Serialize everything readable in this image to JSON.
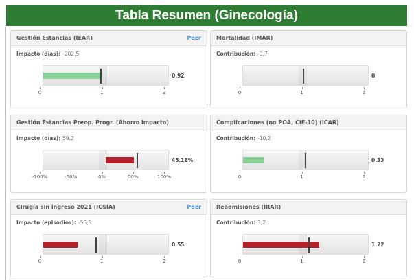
{
  "title": "Tabla Resumen (Ginecología)",
  "colors": {
    "header": "#2f7d32",
    "good": "#86cf96",
    "bad": "#b5212b",
    "peer": "#4a90d9"
  },
  "cards": [
    {
      "title": "Gestión Estancias (IEAR)",
      "peer": "Peer",
      "metric_label": "Impacto (días):",
      "metric_value": "-202,5",
      "value_label": "0.92",
      "value": 0.92,
      "marker": 0.92,
      "min": 0,
      "max": 2,
      "ref": 1,
      "ticks": [
        "0",
        "1",
        "2"
      ],
      "bar_color": "good"
    },
    {
      "title": "Mortalidad (IMAR)",
      "peer": "",
      "metric_label": "Contribución:",
      "metric_value": "-0,7",
      "value_label": "0",
      "value": 0,
      "marker": 0.97,
      "min": 0,
      "max": 2,
      "ref": 1,
      "ticks": [
        "0",
        "1",
        "2"
      ],
      "bar_color": "good"
    },
    {
      "title": "Gestión Estancias Preop. Progr. (Ahorro impacto)",
      "peer": "",
      "metric_label": "Impacto (días):",
      "metric_value": "59,2",
      "value_label": "45.18%",
      "value": 45.18,
      "marker": 50,
      "min": -100,
      "max": 100,
      "ref": 0,
      "ticks": [
        "-100%",
        "-50%",
        "0%",
        "50%",
        "100%"
      ],
      "bar_color": "bad"
    },
    {
      "title": "Complicaciones (no POA, CIE-10) (ICAR)",
      "peer": "",
      "metric_label": "Contribución:",
      "metric_value": "-10,2",
      "value_label": "0.33",
      "value": 0.33,
      "marker": 1.0,
      "min": 0,
      "max": 2,
      "ref": 1,
      "ticks": [
        "0",
        "1",
        "2"
      ],
      "bar_color": "good"
    },
    {
      "title": "Cirugía sin ingreso 2021 (ICSIA)",
      "peer": "Peer",
      "metric_label": "Impacto (episodios):",
      "metric_value": "-56,5",
      "value_label": "0.55",
      "value": 0.55,
      "marker": 0.85,
      "min": 0,
      "max": 2,
      "ref": 1,
      "ticks": [
        "0",
        "1",
        "2"
      ],
      "bar_color": "bad"
    },
    {
      "title": "Readmisiones (IRAR)",
      "peer": "",
      "metric_label": "Contribución:",
      "metric_value": "3,2",
      "value_label": "1.22",
      "value": 1.22,
      "marker": 1.05,
      "min": 0,
      "max": 2,
      "ref": 1,
      "ticks": [
        "0",
        "1",
        "2"
      ],
      "bar_color": "bad"
    }
  ]
}
